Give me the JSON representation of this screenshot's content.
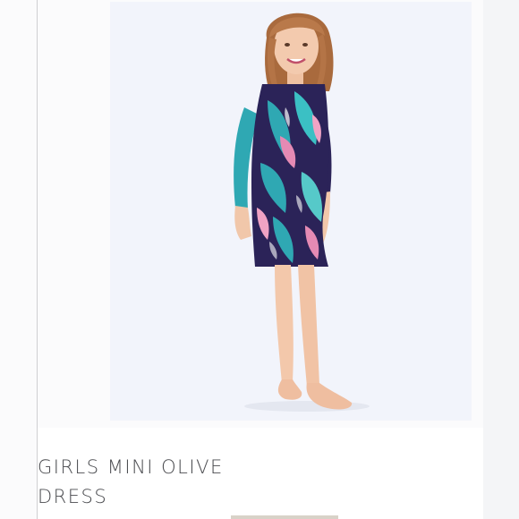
{
  "product": {
    "title_line_1": "GIRLS MINI OLIVE",
    "title_line_2": "DRESS",
    "image_alt": "Girl wearing a navy tropical print shift dress with turquoise and pink leaves",
    "image_subject": "product-photo"
  },
  "colors": {
    "photo_background": "#f2f4fb",
    "dress_navy": "#2b2358",
    "dress_turquoise": "#2fa8b3",
    "dress_pink": "#e58ab4",
    "hair": "#b9794a",
    "skin": "#f1c7aa",
    "title_text": "#4a4b4f"
  }
}
